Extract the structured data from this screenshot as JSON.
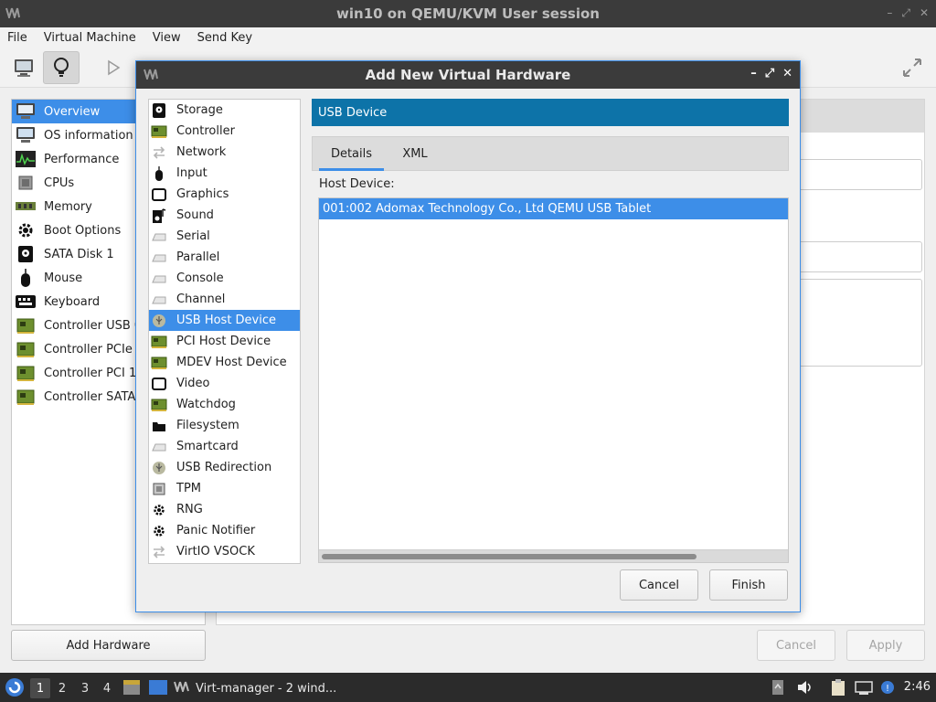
{
  "window": {
    "title": "win10 on QEMU/KVM User session"
  },
  "menubar": {
    "items": [
      "File",
      "Virtual Machine",
      "View",
      "Send Key"
    ]
  },
  "sidebar": {
    "items": [
      {
        "label": "Overview",
        "icon": "monitor-icon",
        "selected": true
      },
      {
        "label": "OS information",
        "icon": "monitor-icon"
      },
      {
        "label": "Performance",
        "icon": "performance-icon"
      },
      {
        "label": "CPUs",
        "icon": "cpu-icon"
      },
      {
        "label": "Memory",
        "icon": "memory-icon"
      },
      {
        "label": "Boot Options",
        "icon": "gear-icon"
      },
      {
        "label": "SATA Disk 1",
        "icon": "disk-icon"
      },
      {
        "label": "Mouse",
        "icon": "mouse-icon"
      },
      {
        "label": "Keyboard",
        "icon": "keyboard-icon"
      },
      {
        "label": "Controller USB 0",
        "icon": "card-icon"
      },
      {
        "label": "Controller PCIe",
        "icon": "card-icon"
      },
      {
        "label": "Controller PCI 1",
        "icon": "card-icon"
      },
      {
        "label": "Controller SATA",
        "icon": "card-icon"
      }
    ]
  },
  "footer": {
    "add_hardware": "Add Hardware",
    "cancel": "Cancel",
    "apply": "Apply"
  },
  "dialog": {
    "title": "Add New Virtual Hardware",
    "devices": [
      {
        "label": "Storage",
        "icon": "storage-icon"
      },
      {
        "label": "Controller",
        "icon": "card-icon"
      },
      {
        "label": "Network",
        "icon": "network-icon"
      },
      {
        "label": "Input",
        "icon": "mouse-icon"
      },
      {
        "label": "Graphics",
        "icon": "display-icon"
      },
      {
        "label": "Sound",
        "icon": "sound-icon"
      },
      {
        "label": "Serial",
        "icon": "serial-icon"
      },
      {
        "label": "Parallel",
        "icon": "serial-icon"
      },
      {
        "label": "Console",
        "icon": "serial-icon"
      },
      {
        "label": "Channel",
        "icon": "serial-icon"
      },
      {
        "label": "USB Host Device",
        "icon": "usb-icon",
        "selected": true
      },
      {
        "label": "PCI Host Device",
        "icon": "card-icon"
      },
      {
        "label": "MDEV Host Device",
        "icon": "card-icon"
      },
      {
        "label": "Video",
        "icon": "display-icon"
      },
      {
        "label": "Watchdog",
        "icon": "card-icon"
      },
      {
        "label": "Filesystem",
        "icon": "folder-icon"
      },
      {
        "label": "Smartcard",
        "icon": "serial-icon"
      },
      {
        "label": "USB Redirection",
        "icon": "usb-icon"
      },
      {
        "label": "TPM",
        "icon": "chip-icon"
      },
      {
        "label": "RNG",
        "icon": "gear-icon"
      },
      {
        "label": "Panic Notifier",
        "icon": "gear-icon"
      },
      {
        "label": "VirtIO VSOCK",
        "icon": "network-icon"
      }
    ],
    "section_title": "USB Device",
    "tabs": [
      "Details",
      "XML"
    ],
    "active_tab": "Details",
    "host_device_label": "Host Device:",
    "host_devices": [
      "001:002 Adomax Technology Co., Ltd QEMU USB Tablet"
    ],
    "cancel": "Cancel",
    "finish": "Finish"
  },
  "taskbar": {
    "workspaces": [
      "1",
      "2",
      "3",
      "4"
    ],
    "active_workspace": "1",
    "task_label": "Virt-manager - 2 wind...",
    "clock": "2:46"
  }
}
